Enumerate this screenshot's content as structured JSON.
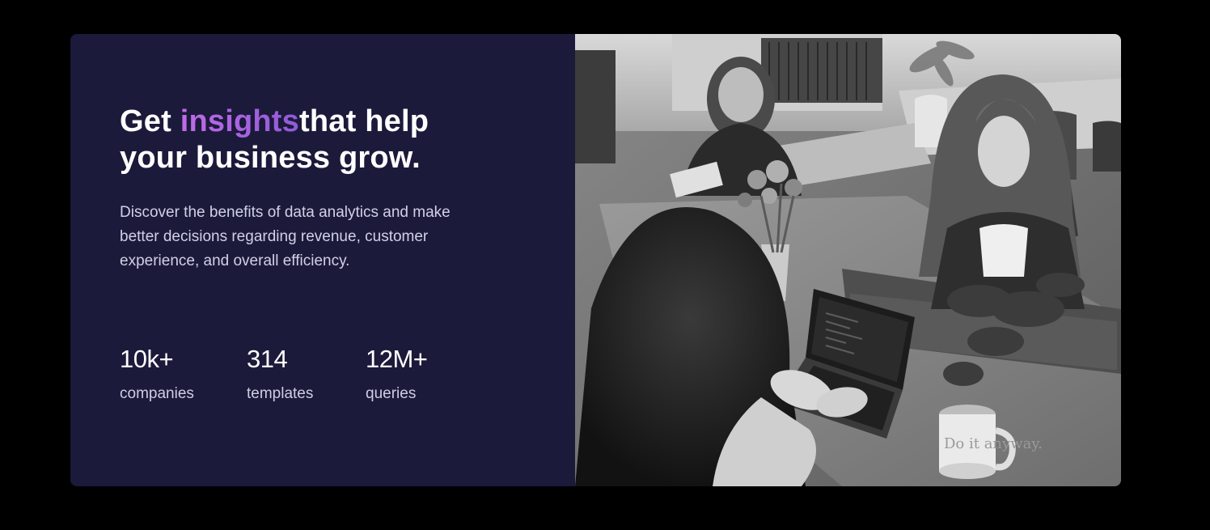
{
  "hero": {
    "headline_prefix": "Get ",
    "headline_accent": "insights",
    "headline_suffix_line1": "that help",
    "headline_line2": "your business grow.",
    "description": "Discover the benefits of data analytics and make better decisions regarding revenue, customer experience, and overall efficiency.",
    "accent_colors": [
      "#c06ce8",
      "#8f5ad8"
    ],
    "background_color": "#1b1a3a"
  },
  "stats": [
    {
      "value": "10k+",
      "label": "companies"
    },
    {
      "value": "314",
      "label": "templates"
    },
    {
      "value": "12M+",
      "label": "queries"
    }
  ],
  "photo": {
    "subject": "office-team-photo",
    "mug_text": "Do it anyway."
  }
}
